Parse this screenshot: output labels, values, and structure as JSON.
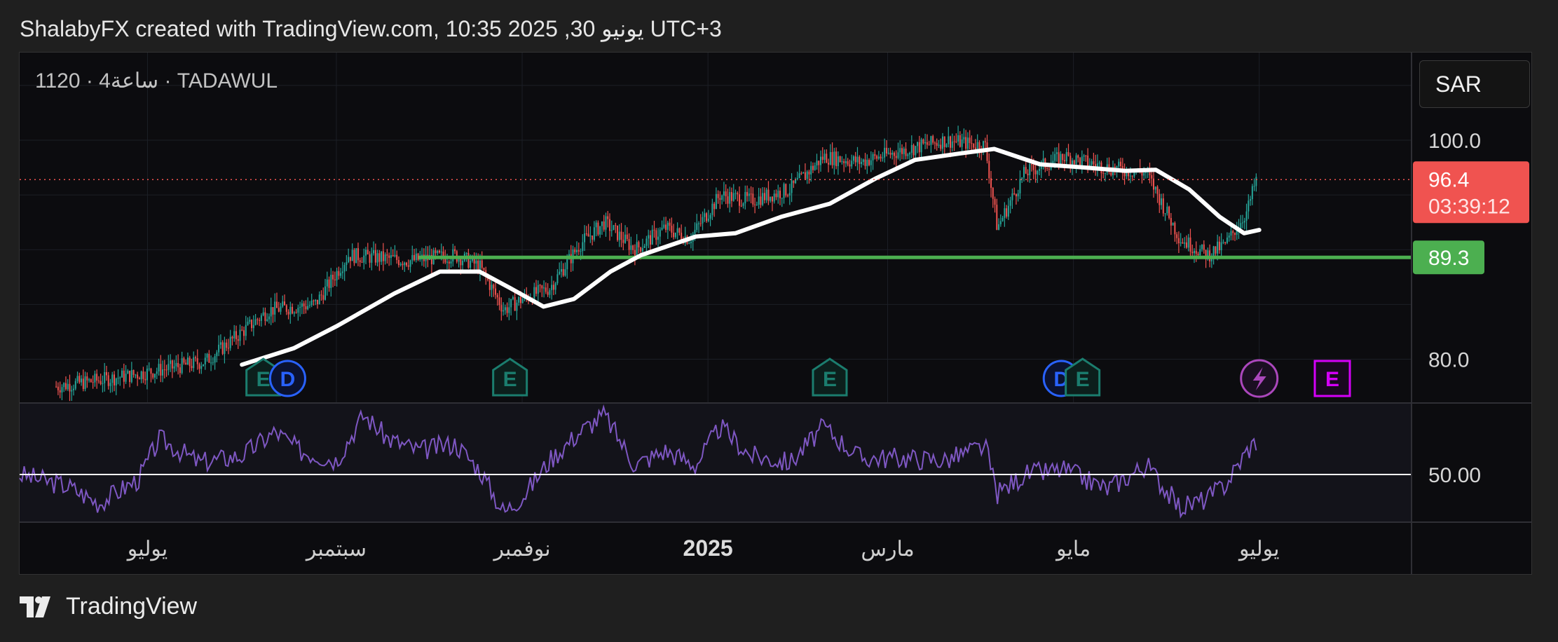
{
  "header": {
    "text": "ShalabyFX created with TradingView.com, 10:35 2025 ,30 يونيو UTC+3"
  },
  "chart": {
    "symbol_label": "1120 · 4ساعة · TADAWUL",
    "currency": "SAR",
    "last_price_label": "96.4",
    "countdown_label": "03:39:12",
    "support_label": "89.3",
    "rsi_midline_label": "50.00"
  },
  "footer": {
    "brand": "TradingView"
  },
  "colors": {
    "up": "#26a69a",
    "down": "#ef5350",
    "ma_line": "#ffffff",
    "support_line": "#4caf50",
    "rsi_line": "#7e57c2",
    "price_badge": "#f05350",
    "support_badge": "#4caf50",
    "earnings_marker": "#1b7d6e",
    "dividend_marker": "#2962ff",
    "split_marker": "#ab47bc",
    "future_earnings_marker": "#d500f9"
  },
  "chart_data": {
    "type": "candlestick",
    "title": "1120 · 4ساعة · TADAWUL",
    "y_axis": {
      "range": [
        76,
        108
      ],
      "tick_labels": [
        "100.0",
        "80.0"
      ],
      "ticks": [
        100,
        80
      ]
    },
    "x_axis": {
      "tick_labels": [
        "يوليو",
        "سبتمبر",
        "نوفمبر",
        "2025",
        "مارس",
        "مايو",
        "يوليو"
      ],
      "tick_dates": [
        "2024-07-01",
        "2024-09-01",
        "2024-11-01",
        "2025-01-01",
        "2025-03-01",
        "2025-05-01",
        "2025-07-01"
      ],
      "range": [
        "2024-05-20",
        "2025-08-20"
      ]
    },
    "price_series": {
      "name": "Close",
      "points": [
        [
          "2024-06-01",
          77.5
        ],
        [
          "2024-06-25",
          78.5
        ],
        [
          "2024-07-20",
          79.8
        ],
        [
          "2024-08-10",
          84.5
        ],
        [
          "2024-08-25",
          85.0
        ],
        [
          "2024-09-05",
          89.5
        ],
        [
          "2024-09-25",
          89.0
        ],
        [
          "2024-10-10",
          89.5
        ],
        [
          "2024-10-18",
          88.5
        ],
        [
          "2024-10-26",
          84.5
        ],
        [
          "2024-11-01",
          85.5
        ],
        [
          "2024-11-10",
          86.5
        ],
        [
          "2024-11-20",
          90.5
        ],
        [
          "2024-11-28",
          92.5
        ],
        [
          "2024-12-08",
          90.0
        ],
        [
          "2024-12-18",
          92.0
        ],
        [
          "2024-12-26",
          91.0
        ],
        [
          "2025-01-05",
          95.0
        ],
        [
          "2025-01-15",
          94.5
        ],
        [
          "2025-01-28",
          95.5
        ],
        [
          "2025-02-08",
          98.5
        ],
        [
          "2025-02-20",
          98.0
        ],
        [
          "2025-03-05",
          99.0
        ],
        [
          "2025-03-20",
          100.0
        ],
        [
          "2025-04-02",
          99.5
        ],
        [
          "2025-04-06",
          92.0
        ],
        [
          "2025-04-15",
          97.0
        ],
        [
          "2025-04-28",
          98.5
        ],
        [
          "2025-05-12",
          97.5
        ],
        [
          "2025-05-25",
          97.0
        ],
        [
          "2025-06-05",
          91.0
        ],
        [
          "2025-06-14",
          89.5
        ],
        [
          "2025-06-20",
          90.5
        ],
        [
          "2025-06-27",
          93.5
        ],
        [
          "2025-06-30",
          96.4
        ]
      ]
    },
    "moving_average": {
      "points": [
        [
          "2024-08-01",
          79.5
        ],
        [
          "2024-08-18",
          81.0
        ],
        [
          "2024-09-01",
          83.0
        ],
        [
          "2024-09-20",
          86.0
        ],
        [
          "2024-10-05",
          88.0
        ],
        [
          "2024-10-18",
          88.0
        ],
        [
          "2024-10-28",
          86.5
        ],
        [
          "2024-11-08",
          84.8
        ],
        [
          "2024-11-18",
          85.5
        ],
        [
          "2024-11-30",
          88.0
        ],
        [
          "2024-12-10",
          89.5
        ],
        [
          "2024-12-28",
          91.2
        ],
        [
          "2025-01-10",
          91.5
        ],
        [
          "2025-01-25",
          93.0
        ],
        [
          "2025-02-10",
          94.2
        ],
        [
          "2025-02-25",
          96.5
        ],
        [
          "2025-03-10",
          98.2
        ],
        [
          "2025-03-25",
          98.8
        ],
        [
          "2025-04-05",
          99.2
        ],
        [
          "2025-04-20",
          97.8
        ],
        [
          "2025-05-05",
          97.5
        ],
        [
          "2025-05-18",
          97.2
        ],
        [
          "2025-05-28",
          97.3
        ],
        [
          "2025-06-08",
          95.5
        ],
        [
          "2025-06-18",
          93.0
        ],
        [
          "2025-06-26",
          91.5
        ],
        [
          "2025-07-01",
          91.8
        ]
      ]
    },
    "support_level": {
      "value": 89.3,
      "from": "2024-09-28",
      "to": "2025-08-20"
    },
    "last_price": 96.4,
    "markers": [
      {
        "type": "E",
        "date": "2024-08-08"
      },
      {
        "type": "D",
        "date": "2024-08-16"
      },
      {
        "type": "E",
        "date": "2024-10-28"
      },
      {
        "type": "E",
        "date": "2025-02-10"
      },
      {
        "type": "D",
        "date": "2025-04-27"
      },
      {
        "type": "E",
        "date": "2025-05-04"
      },
      {
        "type": "split",
        "date": "2025-07-01"
      },
      {
        "type": "E",
        "date": "2025-07-25"
      }
    ],
    "rsi": {
      "midline": 50,
      "range": [
        30,
        80
      ],
      "points": [
        [
          "2024-05-20",
          50
        ],
        [
          "2024-06-05",
          45
        ],
        [
          "2024-06-15",
          38
        ],
        [
          "2024-06-28",
          48
        ],
        [
          "2024-07-05",
          65
        ],
        [
          "2024-07-18",
          55
        ],
        [
          "2024-08-01",
          58
        ],
        [
          "2024-08-12",
          68
        ],
        [
          "2024-08-20",
          60
        ],
        [
          "2024-09-01",
          56
        ],
        [
          "2024-09-10",
          75
        ],
        [
          "2024-09-18",
          65
        ],
        [
          "2024-09-28",
          60
        ],
        [
          "2024-10-10",
          63
        ],
        [
          "2024-10-18",
          52
        ],
        [
          "2024-10-26",
          34
        ],
        [
          "2024-11-02",
          42
        ],
        [
          "2024-11-10",
          56
        ],
        [
          "2024-11-20",
          68
        ],
        [
          "2024-11-28",
          75
        ],
        [
          "2024-12-08",
          54
        ],
        [
          "2024-12-18",
          60
        ],
        [
          "2024-12-28",
          54
        ],
        [
          "2025-01-05",
          70
        ],
        [
          "2025-01-15",
          58
        ],
        [
          "2025-01-28",
          55
        ],
        [
          "2025-02-08",
          70
        ],
        [
          "2025-02-20",
          57
        ],
        [
          "2025-03-05",
          57
        ],
        [
          "2025-03-20",
          56
        ],
        [
          "2025-04-02",
          62
        ],
        [
          "2025-04-06",
          42
        ],
        [
          "2025-04-15",
          50
        ],
        [
          "2025-04-28",
          52
        ],
        [
          "2025-05-12",
          44
        ],
        [
          "2025-05-25",
          54
        ],
        [
          "2025-06-05",
          36
        ],
        [
          "2025-06-14",
          40
        ],
        [
          "2025-06-20",
          46
        ],
        [
          "2025-06-27",
          60
        ],
        [
          "2025-06-30",
          64
        ]
      ]
    }
  }
}
